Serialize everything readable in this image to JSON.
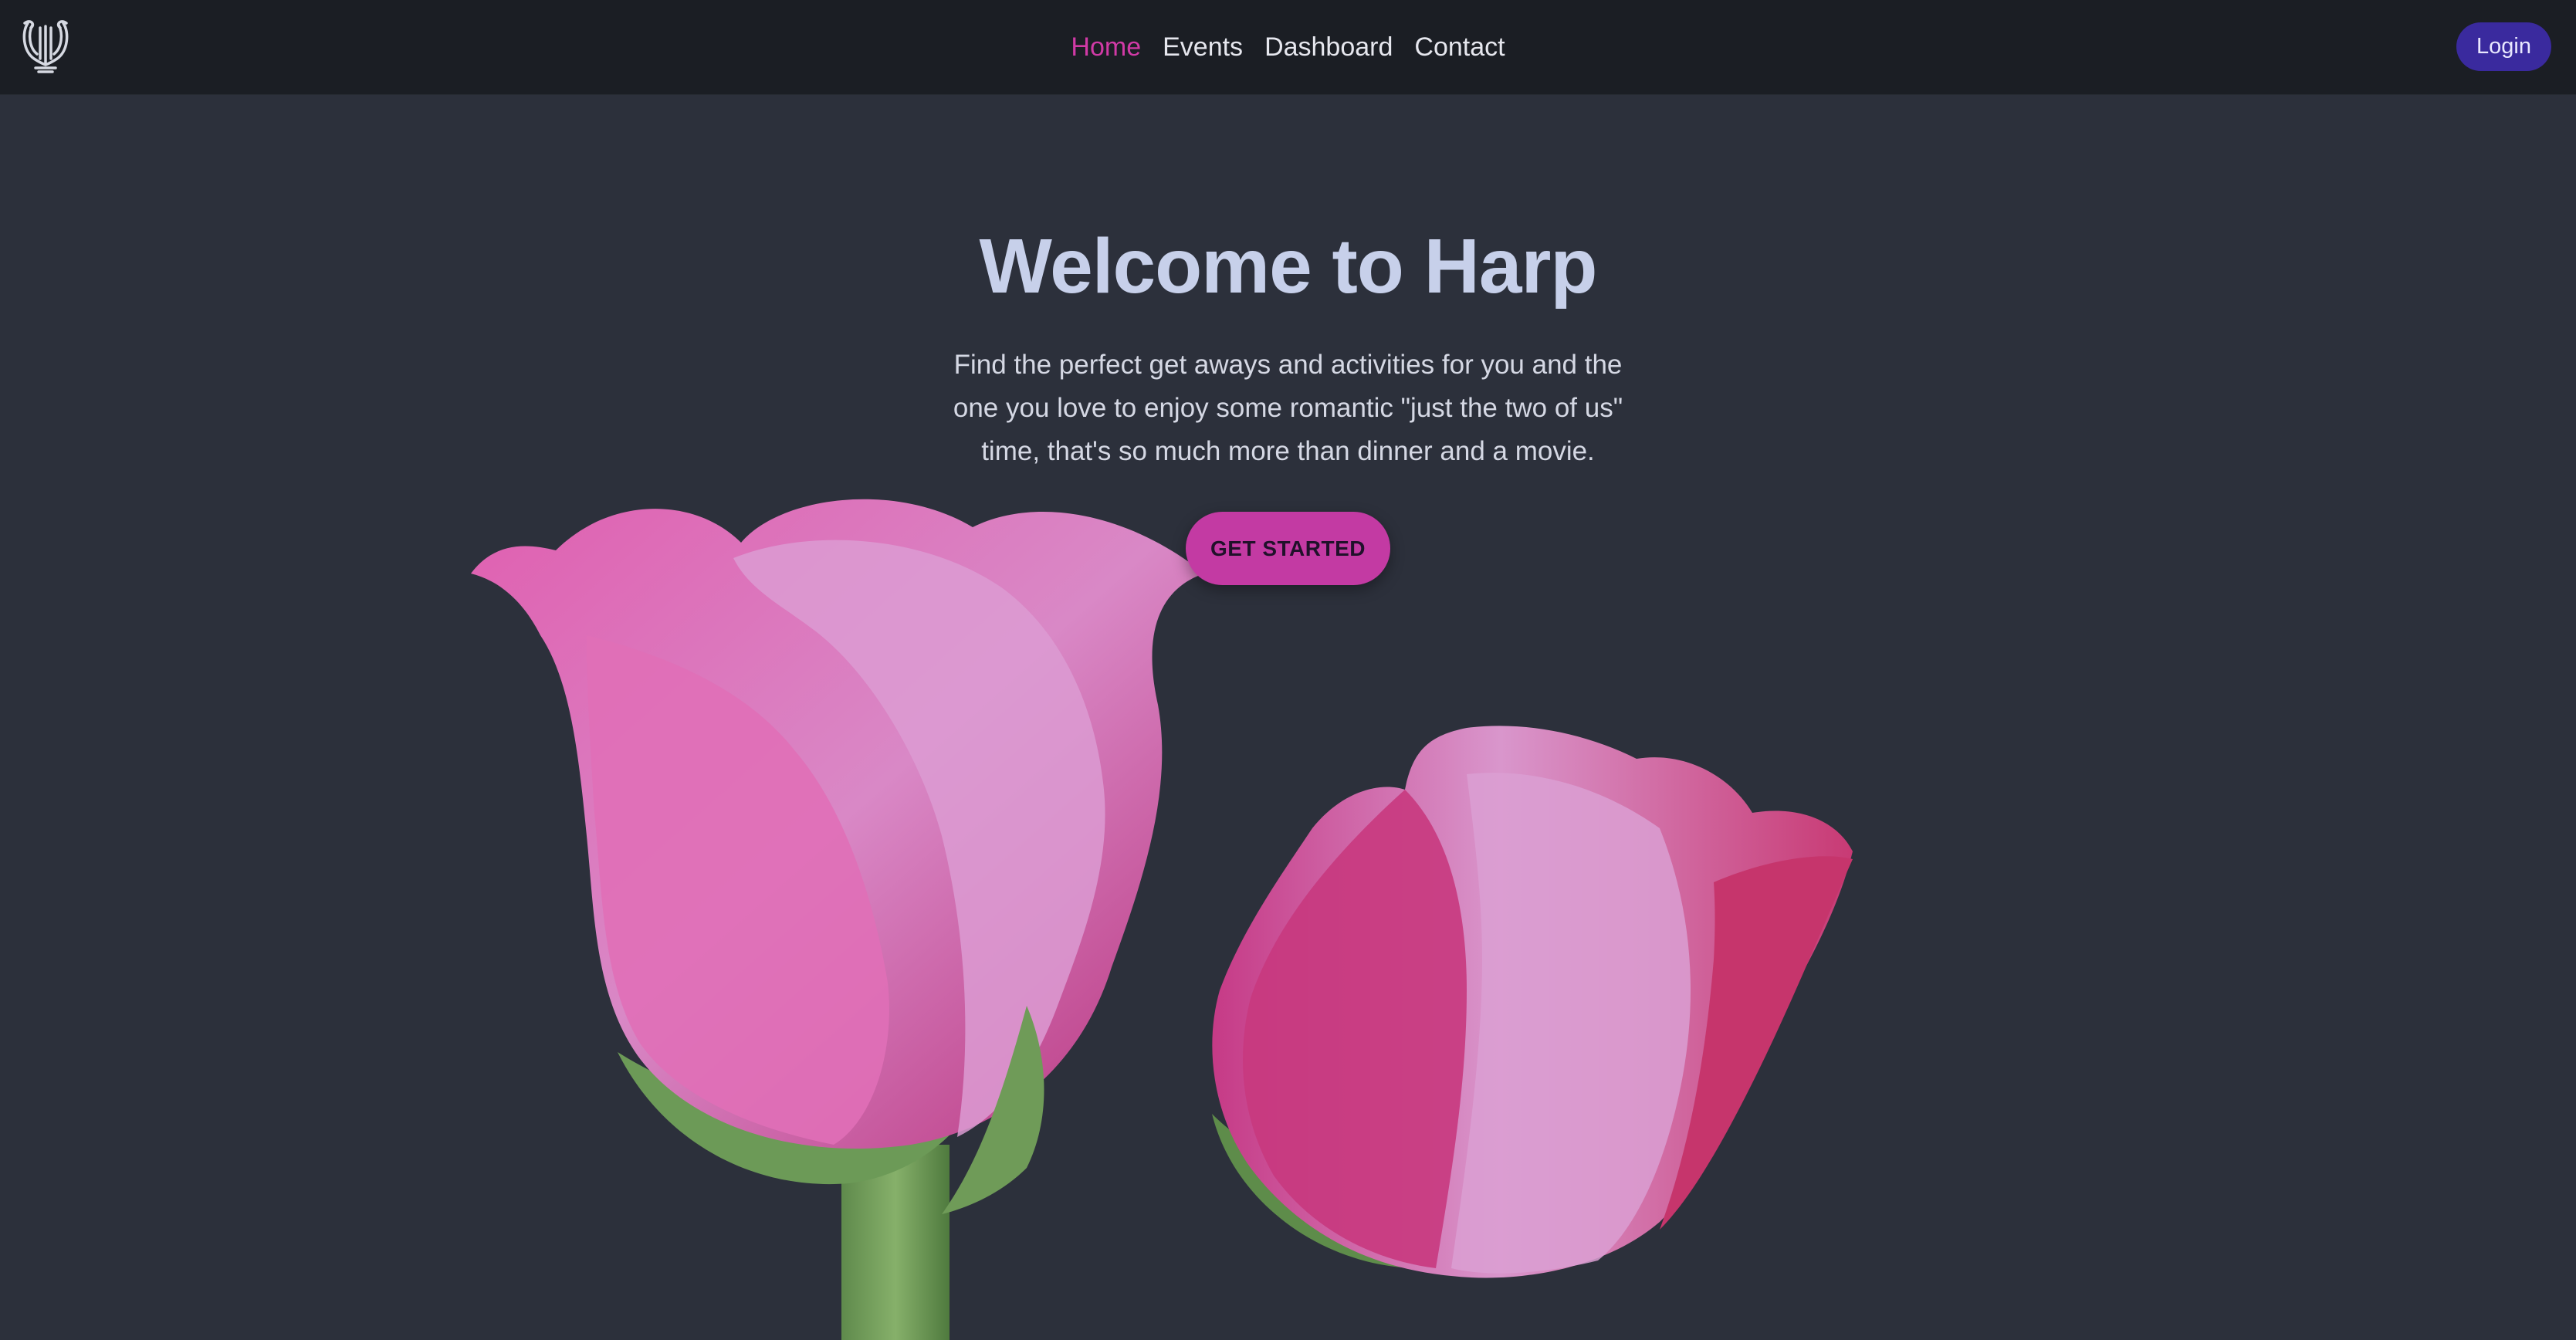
{
  "navbar": {
    "logo_icon": "harp-lyre-icon",
    "links": [
      {
        "label": "Home",
        "active": true
      },
      {
        "label": "Events",
        "active": false
      },
      {
        "label": "Dashboard",
        "active": false
      },
      {
        "label": "Contact",
        "active": false
      }
    ],
    "login_label": "Login"
  },
  "hero": {
    "title": "Welcome to Harp",
    "description": "Find the perfect get aways and activities for you and the one you love to enjoy some romantic \"just the two of us\" time, that's so much more than dinner and a movie.",
    "cta_label": "GET STARTED",
    "background_image": "two-pink-roses-image"
  },
  "colors": {
    "navbar_bg": "#1b1e24",
    "page_bg": "#2c303b",
    "accent_pink": "#d13aa6",
    "login_bg": "#3a2a9e",
    "title_color": "#c7d0ea"
  }
}
